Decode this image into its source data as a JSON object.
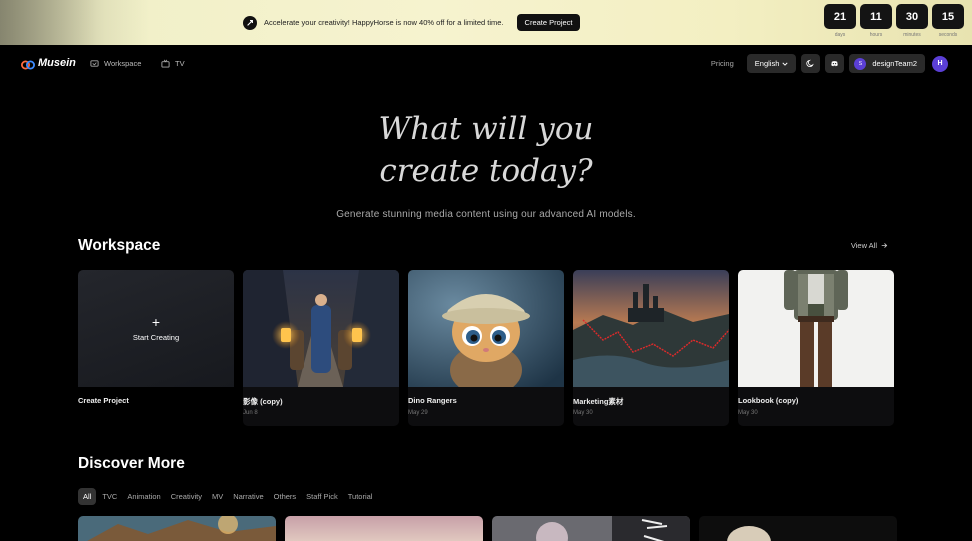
{
  "banner": {
    "message": "Accelerate your creativity! HappyHorse is now 40% off for a limited time.",
    "button": "Create Project",
    "countdown": [
      {
        "value": "21",
        "label": "days"
      },
      {
        "value": "11",
        "label": "hours"
      },
      {
        "value": "30",
        "label": "minutes"
      },
      {
        "value": "15",
        "label": "seconds"
      }
    ]
  },
  "nav": {
    "logo": "Musein",
    "links": [
      "Workspace",
      "TV"
    ],
    "pricing": "Pricing",
    "language": "English",
    "user": "designTeam2",
    "user_initial": "S",
    "avatar_initial": "H"
  },
  "hero": {
    "title_line1": "What will you",
    "title_line2": "create today?",
    "subtitle": "Generate stunning media content using our advanced AI models."
  },
  "workspace": {
    "title": "Workspace",
    "view_all": "View All",
    "create": {
      "label": "Start Creating",
      "title": "Create Project"
    },
    "projects": [
      {
        "title": "影像 (copy)",
        "date": "Jun 8"
      },
      {
        "title": "Dino Rangers",
        "date": "May 29"
      },
      {
        "title": "Marketing素材",
        "date": "May 30"
      },
      {
        "title": "Lookbook (copy)",
        "date": "May 30"
      }
    ]
  },
  "discover": {
    "title": "Discover More",
    "tabs": [
      "All",
      "TVC",
      "Animation",
      "Creativity",
      "MV",
      "Narrative",
      "Others",
      "Staff Pick",
      "Tutorial"
    ],
    "active_tab": "All"
  }
}
